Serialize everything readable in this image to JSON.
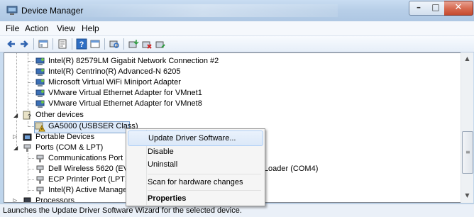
{
  "window": {
    "title": "Device Manager"
  },
  "menu": [
    "File",
    "Action",
    "View",
    "Help"
  ],
  "toolbar_icons": [
    "back-arrow-icon",
    "forward-arrow-icon",
    "show-hide-tree-icon",
    "properties-icon",
    "help-icon",
    "view-icon",
    "scan-hardware-icon",
    "update-driver-icon",
    "uninstall-icon",
    "disable-icon"
  ],
  "tree": {
    "rows": [
      {
        "label": "Intel(R) 82579LM Gigabit Network Connection #2",
        "type": "network"
      },
      {
        "label": "Intel(R) Centrino(R) Advanced-N 6205",
        "type": "network"
      },
      {
        "label": "Microsoft Virtual WiFi Miniport Adapter",
        "type": "network"
      },
      {
        "label": "VMware Virtual Ethernet Adapter for VMnet1",
        "type": "network"
      },
      {
        "label": "VMware Virtual Ethernet Adapter for VMnet8",
        "type": "network"
      },
      {
        "label": "Other devices",
        "type": "category"
      },
      {
        "label": "GA5000 (USBSER Class)",
        "type": "unknown-device"
      },
      {
        "label": "Portable Devices",
        "type": "category"
      },
      {
        "label": "Ports (COM & LPT)",
        "type": "category"
      },
      {
        "label": "Communications Port",
        "type": "port"
      },
      {
        "label": "Dell Wireless 5620 (EV-",
        "type": "port"
      },
      {
        "label": "ECP Printer Port (LPT1",
        "type": "port"
      },
      {
        "label": "Intel(R) Active Manage",
        "type": "port"
      },
      {
        "label": "Processors",
        "type": "category"
      }
    ],
    "obscured_tail": "DLoader (COM4)"
  },
  "context_menu": {
    "items": [
      "Update Driver Software...",
      "Disable",
      "Uninstall",
      "Scan for hardware changes",
      "Properties"
    ]
  },
  "status": {
    "text": "Launches the Update Driver Software Wizard for the selected device."
  },
  "colors": {
    "selection": "#dce9f9",
    "selection_border": "#7da2ce",
    "titlebar": "#b8cfe8",
    "close_button": "#c44a2f"
  }
}
